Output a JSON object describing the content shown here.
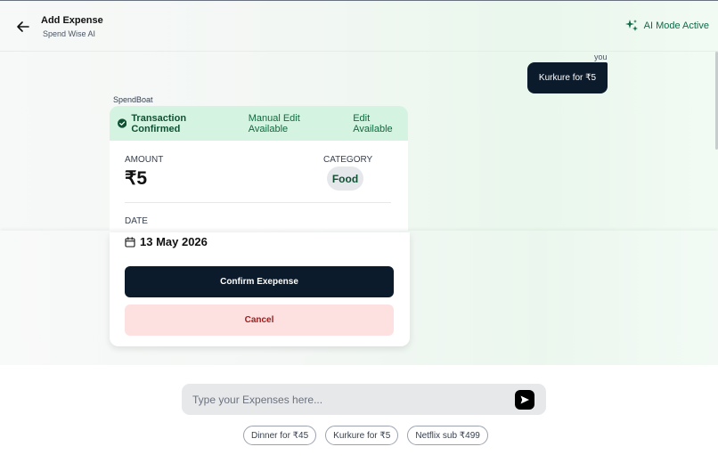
{
  "header": {
    "title": "Add Expense",
    "subtitle": "Spend Wise AI",
    "ai_mode_label": "AI Mode Active"
  },
  "chat": {
    "user_label": "you",
    "user_message": "Kurkure for ₹5",
    "bot_label": "SpendBoat"
  },
  "card": {
    "status": "Transaction Confirmed",
    "manual_edit": "Manual Edit Available",
    "edit": "Edit Available",
    "amount_label": "AMOUNT",
    "amount_value": "₹5",
    "category_label": "CATEGORY",
    "category_value": "Food",
    "date_label": "DATE",
    "date_value": "13 May 2026",
    "confirm_label": "Confirm Exepense",
    "cancel_label": "Cancel"
  },
  "composer": {
    "placeholder": "Type your Expenses here...",
    "value": ""
  },
  "suggestions": [
    "Dinner for ₹45",
    "Kurkure for ₹5",
    "Netflix sub ₹499"
  ],
  "colors": {
    "dark": "#0b1b2b",
    "accent_green": "#0f6b4a",
    "banner_bg": "#d4f3e0",
    "cancel_bg": "#fde1e1",
    "cancel_text": "#9b1c1c"
  },
  "icons": {
    "back": "arrow-left-icon",
    "ai": "sparkle-icon",
    "status": "check-circle-icon",
    "date": "calendar-icon",
    "send": "send-icon"
  }
}
